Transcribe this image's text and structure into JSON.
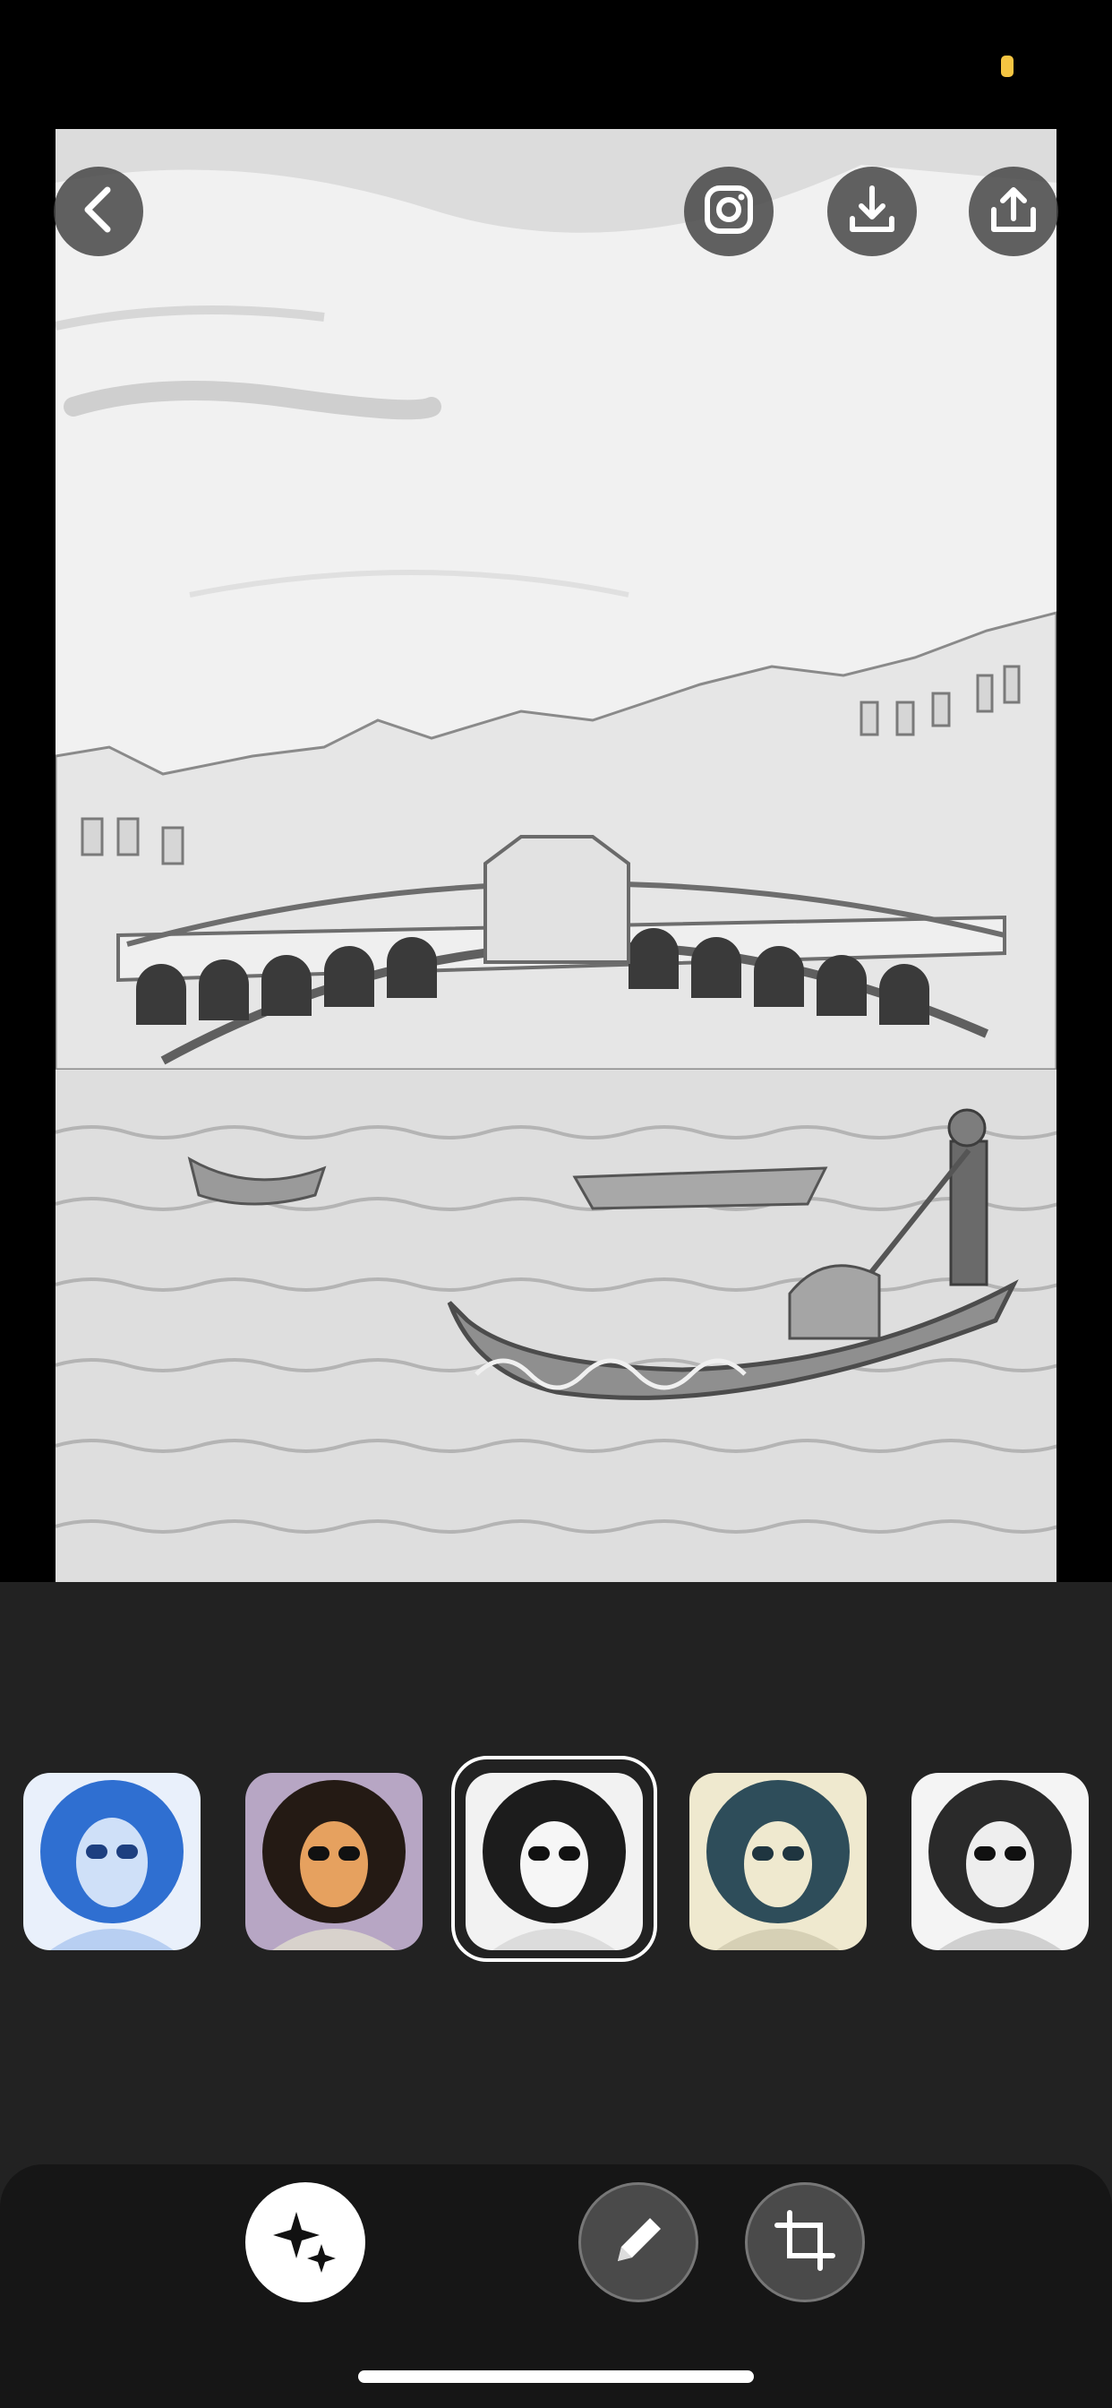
{
  "colors": {
    "background": "#000000",
    "panel": "#222222",
    "toolbar": "#161616",
    "button": "#464646",
    "accent_status": "#f5c542"
  },
  "photo": {
    "description_icon": "sketch-effect-photo"
  },
  "header_buttons": [
    {
      "id": "back",
      "icon": "chevron-left-icon"
    },
    {
      "id": "instagram",
      "icon": "instagram-icon"
    },
    {
      "id": "download",
      "icon": "download-icon"
    },
    {
      "id": "share",
      "icon": "share-icon"
    }
  ],
  "filters": [
    {
      "id": "blue-sketch",
      "tint": "#2f6fd1",
      "selected": false
    },
    {
      "id": "color-pop",
      "tint": "#c98b5a",
      "selected": false
    },
    {
      "id": "bw-sketch",
      "tint": "#2a2a2a",
      "selected": true
    },
    {
      "id": "teal-duotone",
      "tint": "#2e4d5a",
      "selected": false
    },
    {
      "id": "mono",
      "tint": "#555555",
      "selected": false
    }
  ],
  "toolbar": [
    {
      "id": "effects",
      "icon": "sparkles-icon",
      "active": true
    },
    {
      "id": "edit",
      "icon": "pencil-icon",
      "active": false
    },
    {
      "id": "crop",
      "icon": "crop-icon",
      "active": false
    }
  ]
}
